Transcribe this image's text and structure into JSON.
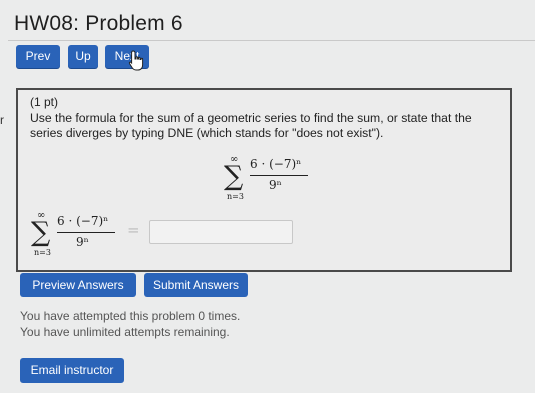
{
  "page": {
    "title": "HW08: Problem 6",
    "edge_mark": "r"
  },
  "nav": {
    "prev_label": "Prev",
    "up_label": "Up",
    "next_label": "Next"
  },
  "problem": {
    "points": "(1 pt)",
    "instructions": "Use the formula for the sum of a geometric series to find the sum, or state that the series diverges by typing DNE (which stands for \"does not exist\").",
    "sum_upper": "∞",
    "sum_lower": "n=3",
    "numerator": "6 · (−7)ⁿ",
    "denominator": "9ⁿ",
    "equals": "=",
    "answer_value": ""
  },
  "actions": {
    "preview_label": "Preview Answers",
    "submit_label": "Submit Answers"
  },
  "status": {
    "attempted": "You have attempted this problem 0 times.",
    "remaining": "You have unlimited attempts remaining."
  },
  "footer": {
    "email_label": "Email instructor"
  },
  "colors": {
    "button_blue": "#2a63b8",
    "page_bg": "#ebecec",
    "box_border": "#4a4a4a"
  },
  "icons": [
    "hand-pointer-icon"
  ]
}
